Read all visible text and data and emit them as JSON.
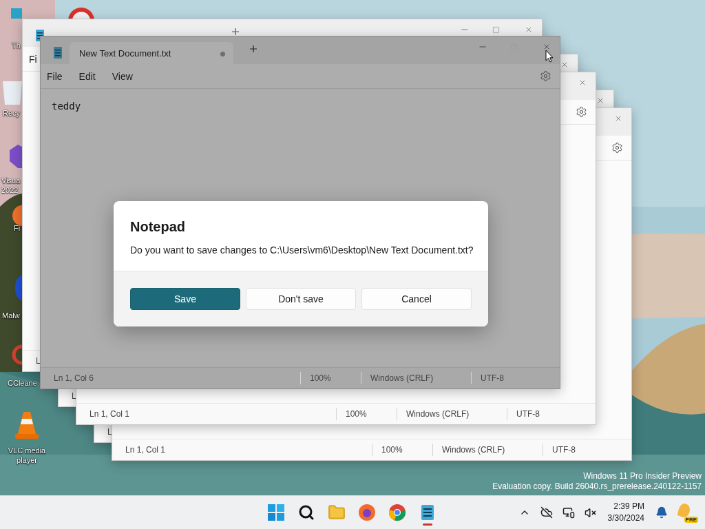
{
  "desktop_icons": [
    {
      "kind": "monitor",
      "label": "Th"
    },
    {
      "kind": "red-app"
    },
    {
      "kind": "bin",
      "label": "Recy"
    },
    {
      "kind": "vs",
      "label": "Visua 2022"
    },
    {
      "kind": "firefox",
      "label": "Fi"
    },
    {
      "kind": "malware",
      "label": "Malw"
    },
    {
      "kind": "ccleaner",
      "label": "CCleane"
    },
    {
      "kind": "vlc",
      "label": "VLC media player"
    }
  ],
  "windows": [
    {
      "dimmed": false,
      "controls": [
        {
          "kind": "app"
        },
        {
          "kind": "new-tab"
        },
        {
          "kind": "minimize"
        },
        {
          "kind": "maximize"
        },
        {
          "kind": "close"
        }
      ],
      "menu": [
        "Fi"
      ],
      "status": [
        "L"
      ]
    },
    {
      "dimmed": true,
      "tab_title": "New Text Document.txt",
      "modified": true,
      "controls": [
        {
          "kind": "app"
        },
        {
          "kind": "new-tab"
        },
        {
          "kind": "minimize"
        },
        {
          "kind": "maximize"
        },
        {
          "kind": "close"
        },
        {
          "kind": "settings"
        }
      ],
      "menu": [
        "File",
        "Edit",
        "View"
      ],
      "text": "teddy",
      "status": [
        "Ln 1, Col 6",
        "100%",
        "Windows (CRLF)",
        "UTF-8"
      ],
      "dialog": {
        "title": "Notepad",
        "message": "Do you want to save changes to C:\\Users\\vm6\\Desktop\\New Text Document.txt?",
        "buttons": [
          {
            "label": "Save",
            "primary": true
          },
          {
            "label": "Don't save",
            "primary": false
          },
          {
            "label": "Cancel",
            "primary": false
          }
        ]
      }
    },
    {
      "dimmed": false,
      "controls": [
        {
          "kind": "close"
        }
      ],
      "status": [
        "L"
      ]
    },
    {
      "dimmed": false,
      "controls": [
        {
          "kind": "close"
        },
        {
          "kind": "settings"
        }
      ],
      "status": [
        "Ln 1, Col 1",
        "100%",
        "Windows (CRLF)",
        "UTF-8"
      ]
    },
    {
      "dimmed": false,
      "controls": [
        {
          "kind": "close"
        }
      ],
      "status": [
        "L"
      ]
    },
    {
      "dimmed": false,
      "controls": [
        {
          "kind": "close"
        },
        {
          "kind": "settings"
        }
      ],
      "status": [
        "Ln 1, Col 1",
        "100%",
        "Windows (CRLF)",
        "UTF-8"
      ]
    }
  ],
  "os_notice": [
    "Windows 11 Pro Insider Preview",
    "Evaluation copy. Build 26040.rs_prerelease.240122-1157"
  ],
  "taskbar": {
    "apps": [
      {
        "kind": "start",
        "active": false
      },
      {
        "kind": "search",
        "active": false
      },
      {
        "kind": "explorer",
        "active": false
      },
      {
        "kind": "firefox",
        "active": false
      },
      {
        "kind": "chrome",
        "active": false
      },
      {
        "kind": "notepad",
        "active": true
      }
    ],
    "tray": [
      {
        "kind": "chevron"
      },
      {
        "kind": "cloud-off"
      },
      {
        "kind": "network"
      },
      {
        "kind": "speaker-muted"
      }
    ],
    "time": "2:39 PM",
    "date": "3/30/2024",
    "copilot_badge": "PRE"
  }
}
